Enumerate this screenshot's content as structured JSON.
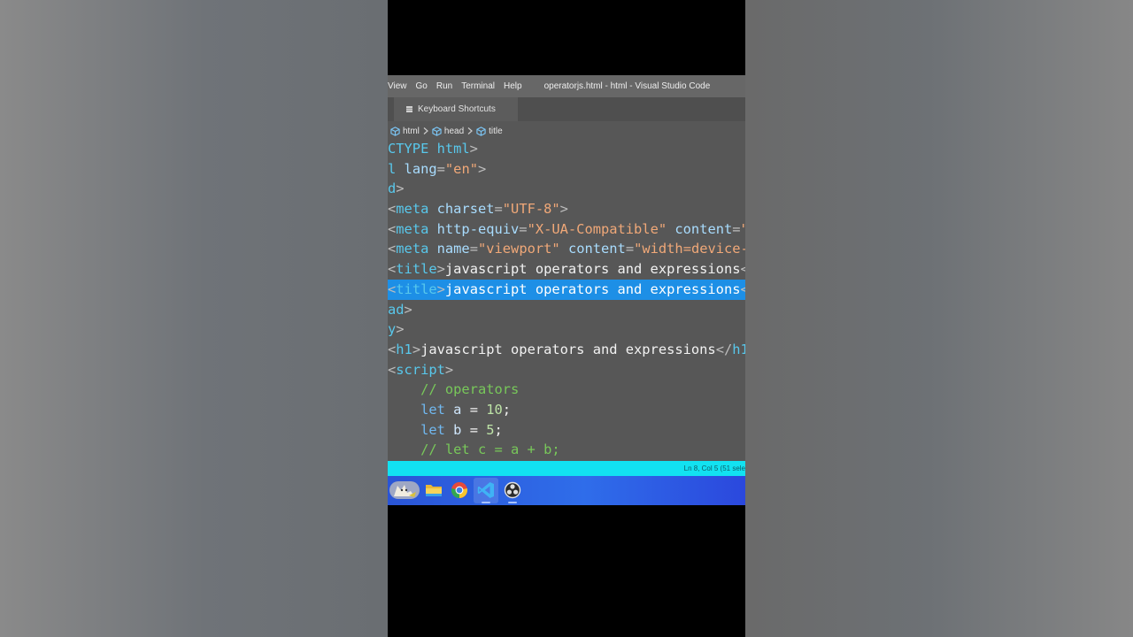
{
  "window": {
    "menus": [
      "View",
      "Go",
      "Run",
      "Terminal",
      "Help"
    ],
    "title": "operatorjs.html - html - Visual Studio Code"
  },
  "tab": {
    "label": "Keyboard Shortcuts",
    "icon": "keyboard-shortcuts-icon"
  },
  "breadcrumb": [
    {
      "label": "html",
      "icon": "symbol-cube-icon"
    },
    {
      "label": "head",
      "icon": "symbol-cube-icon"
    },
    {
      "label": "title",
      "icon": "symbol-cube-icon"
    }
  ],
  "code": {
    "lines": [
      [
        {
          "c": "tag",
          "t": "CTYPE html"
        },
        {
          "c": "pun",
          "t": ">"
        }
      ],
      [
        {
          "c": "tag",
          "t": "l "
        },
        {
          "c": "attr",
          "t": "lang"
        },
        {
          "c": "pun",
          "t": "="
        },
        {
          "c": "str",
          "t": "\"en\""
        },
        {
          "c": "pun",
          "t": ">"
        }
      ],
      [
        {
          "c": "tag",
          "t": "d"
        },
        {
          "c": "pun",
          "t": ">"
        }
      ],
      [
        {
          "c": "pun",
          "t": "<"
        },
        {
          "c": "tag",
          "t": "meta "
        },
        {
          "c": "attr",
          "t": "charset"
        },
        {
          "c": "pun",
          "t": "="
        },
        {
          "c": "str",
          "t": "\"UTF-8\""
        },
        {
          "c": "pun",
          "t": ">"
        }
      ],
      [
        {
          "c": "pun",
          "t": "<"
        },
        {
          "c": "tag",
          "t": "meta "
        },
        {
          "c": "attr",
          "t": "http-equiv"
        },
        {
          "c": "pun",
          "t": "="
        },
        {
          "c": "str",
          "t": "\"X-UA-Compatible\""
        },
        {
          "c": "txt",
          "t": " "
        },
        {
          "c": "attr",
          "t": "content"
        },
        {
          "c": "pun",
          "t": "="
        },
        {
          "c": "str",
          "t": "\""
        }
      ],
      [
        {
          "c": "pun",
          "t": "<"
        },
        {
          "c": "tag",
          "t": "meta "
        },
        {
          "c": "attr",
          "t": "name"
        },
        {
          "c": "pun",
          "t": "="
        },
        {
          "c": "str",
          "t": "\"viewport\""
        },
        {
          "c": "txt",
          "t": " "
        },
        {
          "c": "attr",
          "t": "content"
        },
        {
          "c": "pun",
          "t": "="
        },
        {
          "c": "str",
          "t": "\"width=device-"
        }
      ],
      [
        {
          "c": "pun",
          "t": "<"
        },
        {
          "c": "tag",
          "t": "title"
        },
        {
          "c": "pun",
          "t": ">"
        },
        {
          "c": "txt",
          "t": "javascript operators and expressions"
        },
        {
          "c": "pun",
          "t": "<"
        }
      ],
      [
        {
          "c": "pun",
          "t": "<"
        },
        {
          "c": "tag",
          "t": "title"
        },
        {
          "c": "pun",
          "t": ">"
        },
        {
          "c": "txt",
          "t": "javascript operators and expressions"
        },
        {
          "c": "pun",
          "t": "<"
        }
      ],
      [
        {
          "c": "tag",
          "t": "ad"
        },
        {
          "c": "pun",
          "t": ">"
        }
      ],
      [
        {
          "c": "tag",
          "t": "y"
        },
        {
          "c": "pun",
          "t": ">"
        }
      ],
      [
        {
          "c": "pun",
          "t": "<"
        },
        {
          "c": "tag",
          "t": "h1"
        },
        {
          "c": "pun",
          "t": ">"
        },
        {
          "c": "txt",
          "t": "javascript operators and expressions"
        },
        {
          "c": "pun",
          "t": "</"
        },
        {
          "c": "tag",
          "t": "h1"
        }
      ],
      [
        {
          "c": "pun",
          "t": "<"
        },
        {
          "c": "tag",
          "t": "script"
        },
        {
          "c": "pun",
          "t": ">"
        }
      ],
      [
        {
          "c": "txt",
          "t": "    "
        },
        {
          "c": "cmt",
          "t": "// operators"
        }
      ],
      [
        {
          "c": "txt",
          "t": "    "
        },
        {
          "c": "kw",
          "t": "let "
        },
        {
          "c": "ident",
          "t": "a"
        },
        {
          "c": "txt",
          "t": " = "
        },
        {
          "c": "num",
          "t": "10"
        },
        {
          "c": "txt",
          "t": ";"
        }
      ],
      [
        {
          "c": "txt",
          "t": "    "
        },
        {
          "c": "kw",
          "t": "let "
        },
        {
          "c": "ident",
          "t": "b"
        },
        {
          "c": "txt",
          "t": " = "
        },
        {
          "c": "num",
          "t": "5"
        },
        {
          "c": "txt",
          "t": ";"
        }
      ],
      [
        {
          "c": "txt",
          "t": "    "
        },
        {
          "c": "cmt",
          "t": "// let c = a + b;"
        }
      ]
    ],
    "selected_line": 7
  },
  "statusbar": {
    "text": "Ln 8, Col 5 (51 sele"
  },
  "taskbar": {
    "items": [
      {
        "name": "app-avatar-icon"
      },
      {
        "name": "file-explorer-icon"
      },
      {
        "name": "chrome-icon"
      },
      {
        "name": "vscode-icon",
        "active": true
      },
      {
        "name": "obs-studio-icon"
      }
    ]
  }
}
